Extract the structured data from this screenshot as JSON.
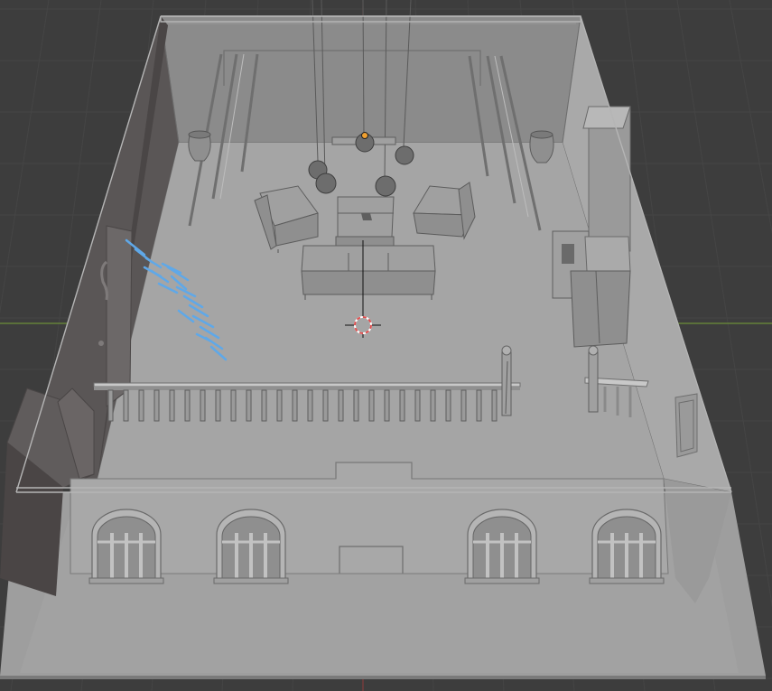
{
  "viewport": {
    "background_color": "#3d3d3d",
    "grid_color": "#454545",
    "x_axis_color": "#6b8f3a",
    "y_axis_color": "#8f3a3a",
    "selection_color": "#5fa8e8",
    "origin_color": "#f0a030",
    "cursor_colors": [
      "#e05050",
      "#ffffff"
    ]
  },
  "scene": {
    "objects": [
      "floor-slab",
      "back-wall",
      "left-wall",
      "right-wall",
      "front-wall",
      "sofa",
      "armchair-left",
      "armchair-right",
      "coffee-table",
      "pendant-lamps",
      "vase-left",
      "vase-right",
      "fireplace-chimney",
      "bookshelf",
      "balcony-railing",
      "stair-railing-left",
      "stair-railing-right",
      "arched-window-1",
      "arched-window-2",
      "arched-window-3",
      "arched-window-4",
      "wall-frame",
      "selected-object"
    ],
    "selected_object": "selected-object",
    "cursor_icon": "3d-cursor-icon",
    "origin_icon": "object-origin-icon"
  }
}
